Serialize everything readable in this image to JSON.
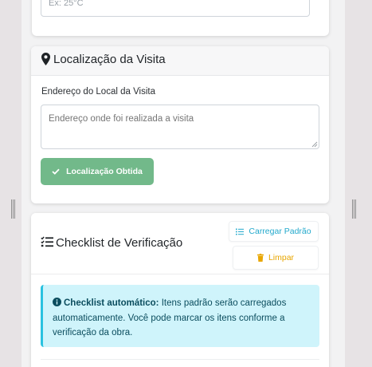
{
  "temperature": {
    "placeholder": "Ex: 25°C"
  },
  "location_section": {
    "title": "Localização da Visita",
    "icon": "map-marker-icon",
    "address_label": "Endereço do Local da Visita",
    "address_placeholder": "Endereço onde foi realizada a visita",
    "located_button_label": "Localização Obtida",
    "located_button_icon": "check-icon",
    "located_button_color": "#72b98a"
  },
  "checklist_section": {
    "title": "Checklist de Verificação",
    "icon": "checklist-icon",
    "load_default_label": "Carregar Padrão",
    "load_default_icon": "list-icon",
    "load_default_color": "#23a9cc",
    "clear_label": "Limpar",
    "clear_icon": "trash-icon",
    "clear_color": "#e8a600",
    "alert": {
      "icon": "info-circle-icon",
      "title": "Checklist automático:",
      "text": "Itens padrão serão carregados automaticamente. Você pode marcar os itens conforme a verificação da obra.",
      "background": "#cff4fb",
      "border_color": "#29c2e0"
    }
  }
}
